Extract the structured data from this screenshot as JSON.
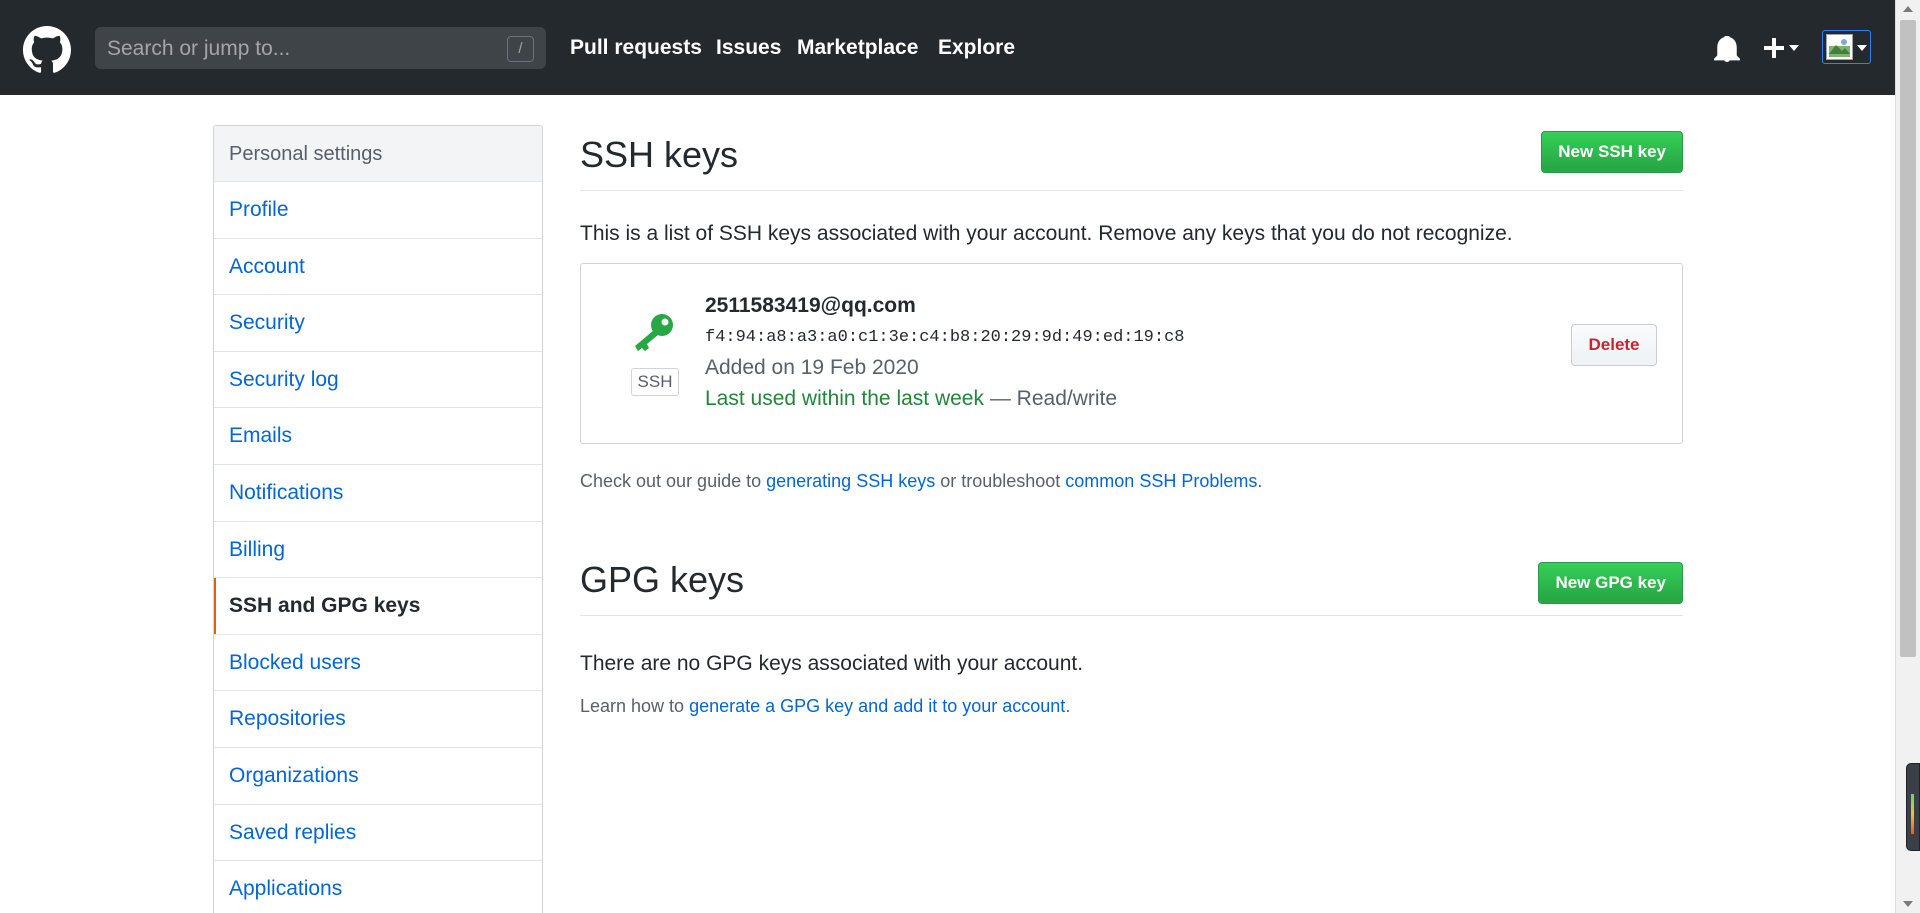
{
  "header": {
    "search_placeholder": "Search or jump to...",
    "search_shortcut": "/",
    "nav": [
      "Pull requests",
      "Issues",
      "Marketplace",
      "Explore"
    ],
    "icons": [
      "github-logo-icon",
      "bell-icon",
      "plus-icon",
      "avatar-image-icon"
    ]
  },
  "sidebar": {
    "title": "Personal settings",
    "items": [
      {
        "label": "Profile"
      },
      {
        "label": "Account"
      },
      {
        "label": "Security"
      },
      {
        "label": "Security log"
      },
      {
        "label": "Emails"
      },
      {
        "label": "Notifications"
      },
      {
        "label": "Billing"
      },
      {
        "label": "SSH and GPG keys"
      },
      {
        "label": "Blocked users"
      },
      {
        "label": "Repositories"
      },
      {
        "label": "Organizations"
      },
      {
        "label": "Saved replies"
      },
      {
        "label": "Applications"
      }
    ],
    "selected": "SSH and GPG keys"
  },
  "ssh": {
    "title": "SSH keys",
    "new_button": "New SSH key",
    "intro": "This is a list of SSH keys associated with your account. Remove any keys that you do not recognize.",
    "key": {
      "badge": "SSH",
      "title": "2511583419@qq.com",
      "fingerprint": "f4:94:a8:a3:a0:c1:3e:c4:b8:20:29:9d:49:ed:19:c8",
      "added": "Added on 19 Feb 2020",
      "last_used": "Last used within the last week",
      "access": " — Read/write",
      "delete_button": "Delete"
    },
    "guide": {
      "prefix": "Check out our guide to ",
      "link1": "generating SSH keys",
      "middle": " or troubleshoot ",
      "link2": "common SSH Problems",
      "suffix": "."
    }
  },
  "gpg": {
    "title": "GPG keys",
    "new_button": "New GPG key",
    "empty": "There are no GPG keys associated with your account.",
    "learn_prefix": "Learn how to ",
    "learn_link": "generate a GPG key and add it to your account",
    "learn_suffix": "."
  },
  "colors": {
    "header_bg": "#24292e",
    "link": "#0366d6",
    "green": "#28a745",
    "danger": "#cb2431",
    "selected_marker": "#e36209"
  }
}
